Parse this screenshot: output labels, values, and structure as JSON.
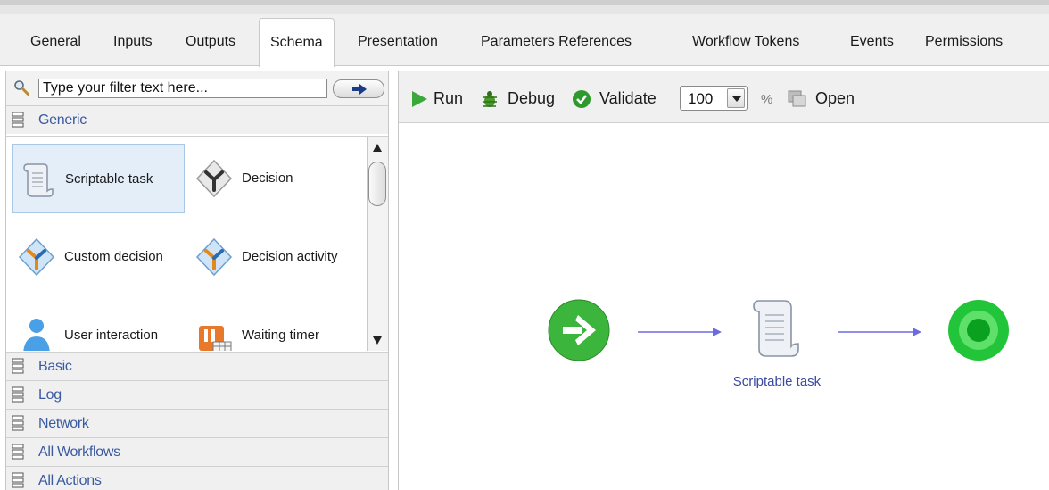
{
  "tabs": [
    {
      "label": "General"
    },
    {
      "label": "Inputs"
    },
    {
      "label": "Outputs"
    },
    {
      "label": "Schema",
      "active": true
    },
    {
      "label": "Presentation"
    },
    {
      "label": "Parameters References"
    },
    {
      "label": "Workflow Tokens"
    },
    {
      "label": "Events"
    },
    {
      "label": "Permissions"
    }
  ],
  "palette": {
    "filter_value": "Type your filter text here...",
    "active_category": "Generic",
    "items": [
      {
        "label": "Scriptable task",
        "icon": "scroll-icon",
        "selected": true
      },
      {
        "label": "Decision",
        "icon": "decision-icon"
      },
      {
        "label": "Custom decision",
        "icon": "custom-decision-icon"
      },
      {
        "label": "Decision activity",
        "icon": "decision-activity-icon"
      },
      {
        "label": "User interaction",
        "icon": "user-icon"
      },
      {
        "label": "Waiting timer",
        "icon": "timer-icon"
      }
    ],
    "categories": [
      "Basic",
      "Log",
      "Network",
      "All Workflows",
      "All Actions"
    ]
  },
  "toolbar": {
    "run": "Run",
    "debug": "Debug",
    "validate": "Validate",
    "zoom": "100",
    "zoom_unit": "%",
    "open": "Open"
  },
  "schema": {
    "task_label": "Scriptable task"
  },
  "colors": {
    "category_text": "#3a5aa0",
    "connector": "#6b6be0",
    "start_green": "#3bb53b",
    "end_green": "#22c43a",
    "selection": "#e3eef9"
  }
}
